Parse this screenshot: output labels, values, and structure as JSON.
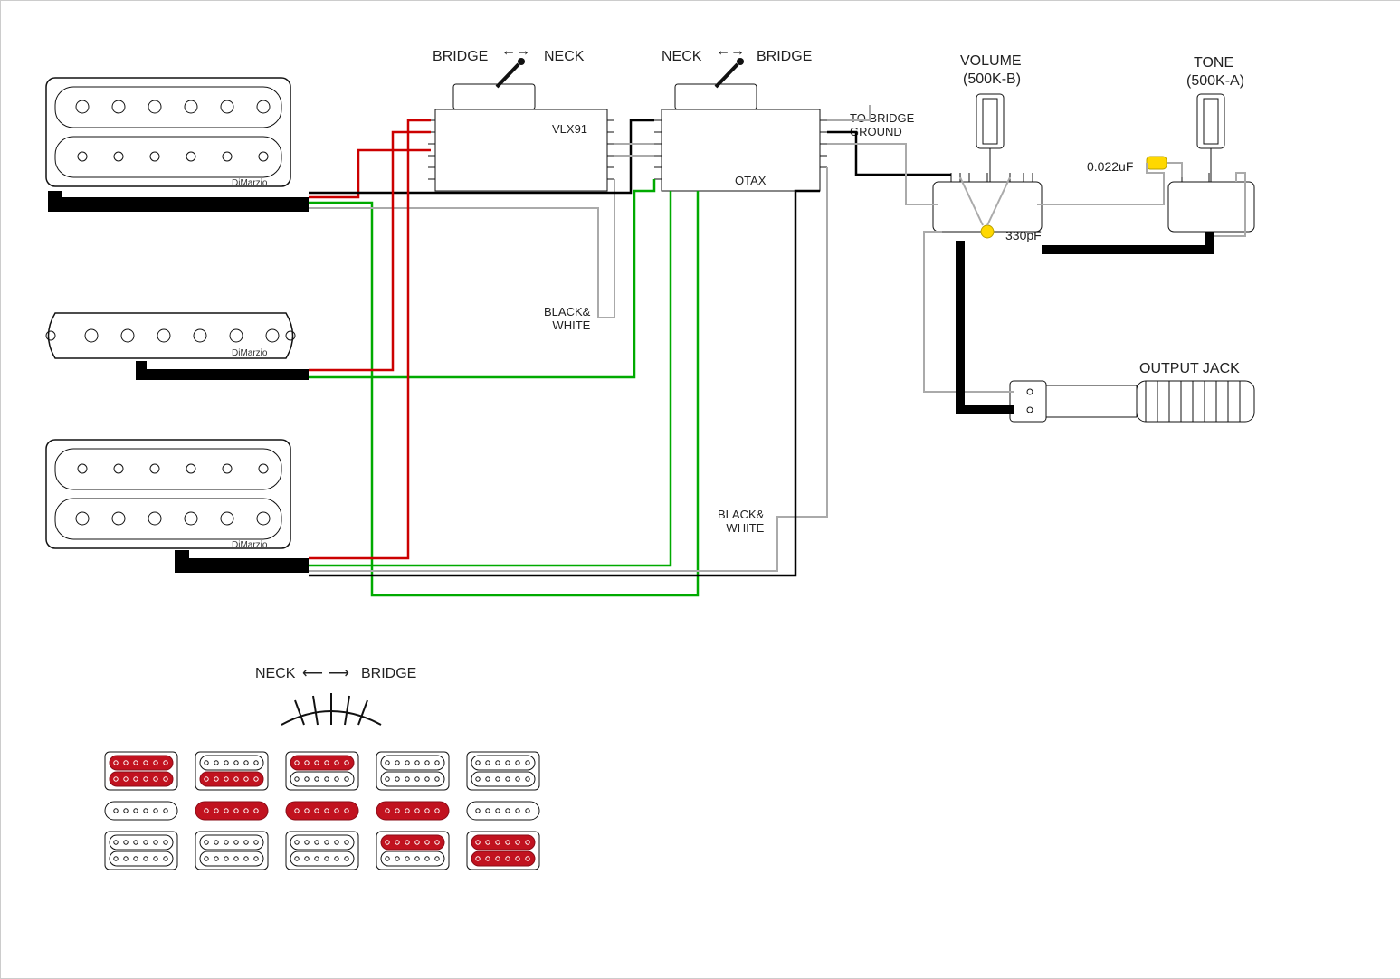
{
  "labels": {
    "switch1_bridge": "BRIDGE",
    "switch1_neck": "NECK",
    "switch2_neck": "NECK",
    "switch2_bridge": "BRIDGE",
    "switch1_model": "VLX91",
    "switch2_model": "OTAX",
    "volume_title": "VOLUME",
    "volume_value": "(500K-B)",
    "tone_title": "TONE",
    "tone_value": "(500K-A)",
    "to_bridge_ground": "TO BRIDGE\nGROUND",
    "cap_tone": "0.022uF",
    "cap_vol": "330pF",
    "black_white_1": "BLACK&\nWHITE",
    "black_white_2": "BLACK&\nWHITE",
    "output_jack": "OUTPUT JACK",
    "pickup_brand": "DiMarzio",
    "legend_neck": "NECK",
    "legend_bridge": "BRIDGE",
    "arrow_left": "←→",
    "arrow_right": "←→",
    "legend_arrow": "⟵⟶"
  },
  "pickup_positions": {
    "columns": 5,
    "active": {
      "0": "hum_both",
      "1": "hum_bottom,single",
      "2": "single,hum_top",
      "3": "single,hum2_top",
      "4": "hum2_both"
    }
  }
}
